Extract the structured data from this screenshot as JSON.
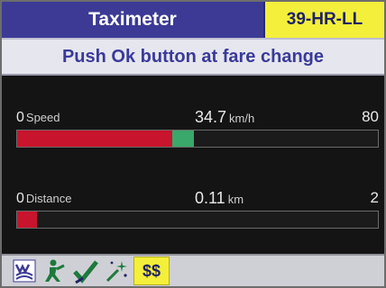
{
  "title": "Taximeter",
  "license_plate": "39-HR-LL",
  "message": "Push Ok  button at fare change",
  "speed": {
    "min": "0",
    "label": "Speed",
    "value": "34.7",
    "unit": "km/h",
    "max": "80",
    "fill_fraction": 0.43
  },
  "distance": {
    "min": "0",
    "label": "Distance",
    "value": "0.11",
    "unit": "km",
    "max": "2",
    "fill_fraction": 0.055
  },
  "toolbar": {
    "icons": [
      "logo-icon",
      "driver-icon",
      "check-icon",
      "sparkle-tool-icon"
    ],
    "fare_button_label": "$$"
  },
  "colors": {
    "title_bg": "#3c3a95",
    "plate_bg": "#f3ef3a",
    "bar_fill": "#c8142c",
    "speed_marker": "#3aa86a"
  }
}
